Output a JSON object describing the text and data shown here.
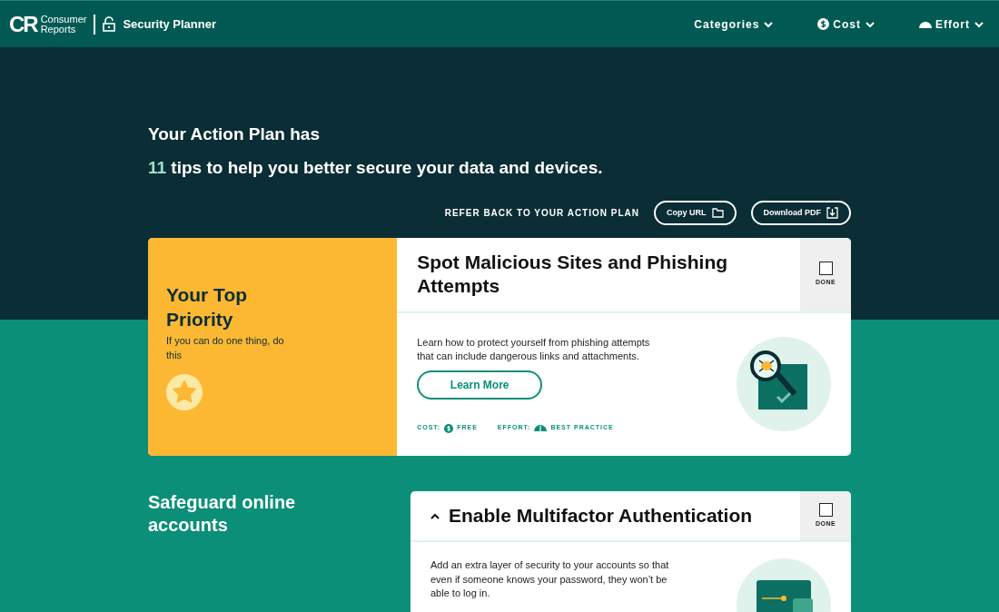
{
  "header": {
    "brand_top": "Consumer",
    "brand_bottom": "Reports",
    "logo": "CR",
    "product": "Security Planner",
    "menus": [
      {
        "label": "Categories",
        "kind": "plain"
      },
      {
        "label": "Cost",
        "kind": "cost"
      },
      {
        "label": "Effort",
        "kind": "effort"
      }
    ]
  },
  "hero": {
    "line1": "Your Action Plan has",
    "count": "11",
    "line2": "tips to help you better secure your data and devices.",
    "refer": "REFER BACK TO YOUR ACTION PLAN",
    "buttons": [
      {
        "label": "Copy URL",
        "kind": "folder"
      },
      {
        "label": "Download PDF",
        "kind": "download"
      }
    ]
  },
  "top_priority": {
    "title": "Your Top Priority",
    "subtitle": "If you can do one thing, do this",
    "tip": {
      "title": "Spot Malicious Sites and Phishing Attempts",
      "done": false,
      "done_label": "DONE",
      "description": "Learn how to protect yourself from phishing attempts that can include dangerous links and attachments.",
      "button": "Learn More",
      "cost_label": "COST:",
      "cost": "FREE",
      "effort_label": "EFFORT:",
      "effort": "BEST PRACTICE"
    }
  },
  "sections": [
    {
      "title": "Safeguard online accounts",
      "tip": {
        "title": "Enable Multifactor Authentication",
        "expanded": true,
        "done": false,
        "done_label": "DONE",
        "description": "Add an extra layer of security to your accounts so that even if someone knows your password, they won’t be able to log in."
      }
    }
  ]
}
